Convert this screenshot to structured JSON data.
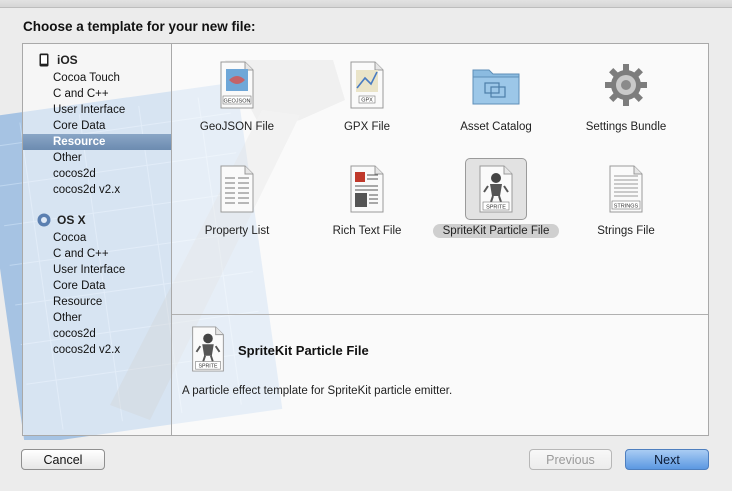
{
  "header": {
    "title": "Choose a template for your new file:"
  },
  "sidebar": {
    "groups": [
      {
        "label": "iOS",
        "icon": "iphone-icon",
        "items": [
          "Cocoa Touch",
          "C and C++",
          "User Interface",
          "Core Data",
          "Resource",
          "Other",
          "cocos2d",
          "cocos2d v2.x"
        ],
        "selected": "Resource"
      },
      {
        "label": "OS X",
        "icon": "osx-icon",
        "items": [
          "Cocoa",
          "C and C++",
          "User Interface",
          "Core Data",
          "Resource",
          "Other",
          "cocos2d",
          "cocos2d v2.x"
        ]
      }
    ]
  },
  "templates": [
    {
      "label": "GeoJSON File",
      "icon": "geojson-file-icon",
      "badge": "GEOJSON"
    },
    {
      "label": "GPX File",
      "icon": "gpx-file-icon",
      "badge": "GPX"
    },
    {
      "label": "Asset Catalog",
      "icon": "asset-catalog-folder-icon"
    },
    {
      "label": "Settings Bundle",
      "icon": "settings-gear-icon"
    },
    {
      "label": "Property List",
      "icon": "property-list-icon"
    },
    {
      "label": "Rich Text File",
      "icon": "rich-text-file-icon"
    },
    {
      "label": "SpriteKit Particle File",
      "icon": "sprite-file-icon",
      "badge": "SPRITE",
      "selected": true
    },
    {
      "label": "Strings File",
      "icon": "strings-file-icon",
      "badge": "STRINGS"
    }
  ],
  "detail": {
    "title": "SpriteKit Particle File",
    "description": "A particle effect template for SpriteKit particle emitter.",
    "badge": "SPRITE"
  },
  "buttons": {
    "cancel": "Cancel",
    "previous": "Previous",
    "next": "Next"
  },
  "colors": {
    "selection": "#7b97bb",
    "default_button": "#5c98e2"
  }
}
